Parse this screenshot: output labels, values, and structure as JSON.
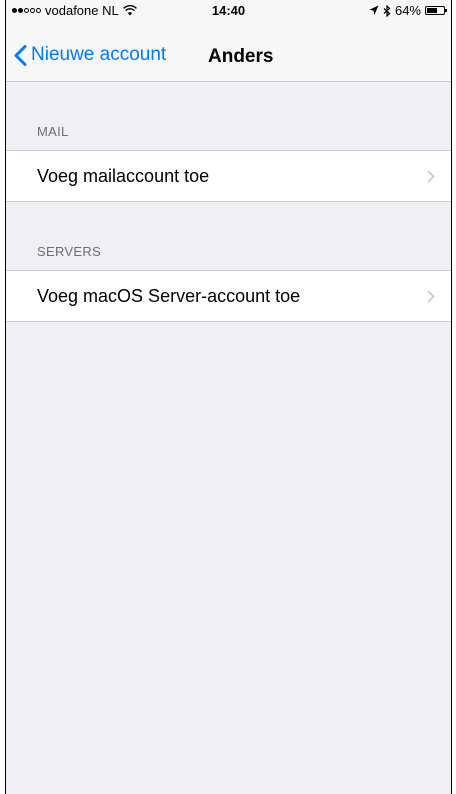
{
  "status_bar": {
    "carrier": "vodafone NL",
    "time": "14:40",
    "battery": "64%",
    "battery_level": 0.64
  },
  "nav": {
    "back_label": "Nieuwe account",
    "title": "Anders"
  },
  "sections": [
    {
      "header": "MAIL",
      "rows": [
        {
          "label": "Voeg mailaccount toe"
        }
      ]
    },
    {
      "header": "SERVERS",
      "rows": [
        {
          "label": "Voeg macOS Server-account toe"
        }
      ]
    }
  ],
  "colors": {
    "accent": "#007aff",
    "background": "#efeff4",
    "separator": "#c8c7cc"
  }
}
